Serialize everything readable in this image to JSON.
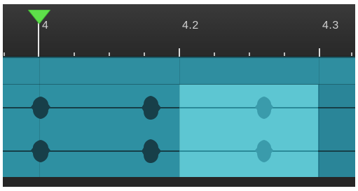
{
  "timeline": {
    "ruler_labels": [
      "4",
      "4.2",
      "4.3"
    ]
  },
  "track": {
    "selection_region": "4.2 – 4.3"
  },
  "colors": {
    "clip": "#2e90a2",
    "selection": "#5dc6d2",
    "playhead": "#5ee04a"
  },
  "icons": {
    "playhead": "playhead-triangle-icon"
  }
}
